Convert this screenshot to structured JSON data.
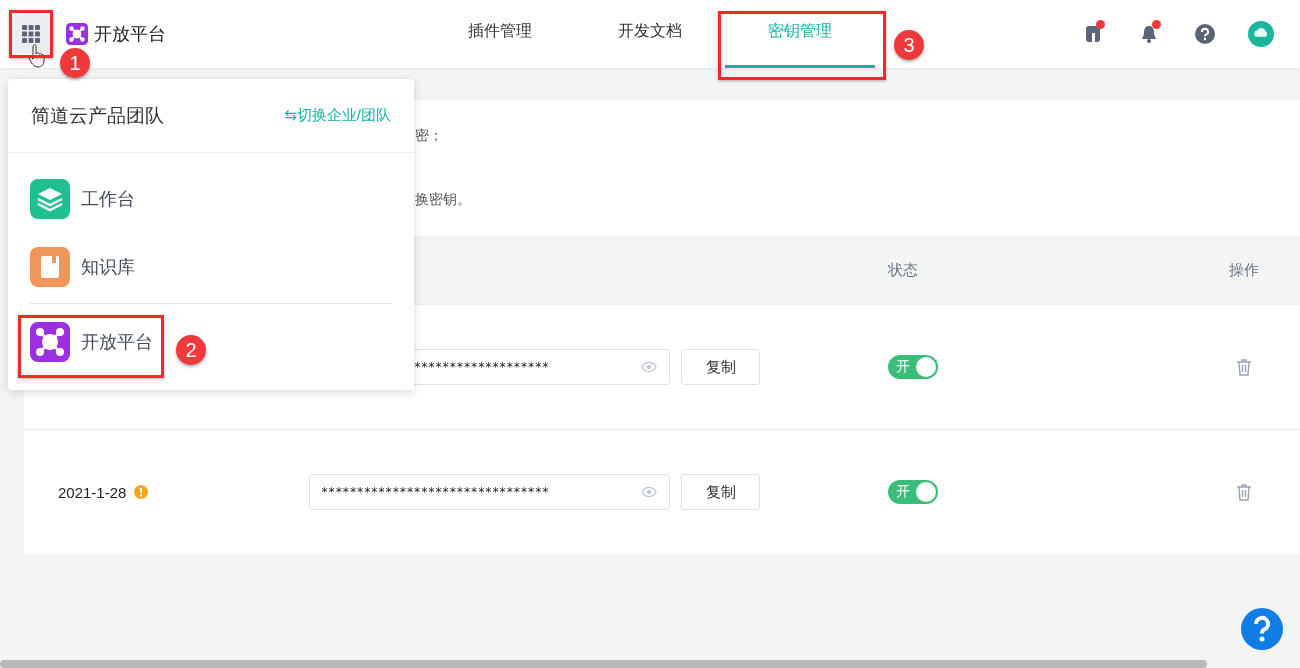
{
  "header": {
    "app_name": "开放平台",
    "tabs": [
      {
        "label": "插件管理",
        "selected": false
      },
      {
        "label": "开发文档",
        "selected": false
      },
      {
        "label": "密钥管理",
        "selected": true
      }
    ],
    "icons": [
      {
        "kind": "notebook",
        "unread": true
      },
      {
        "kind": "bell",
        "unread": true
      },
      {
        "kind": "help",
        "unread": false
      },
      {
        "kind": "avatar",
        "unread": false
      }
    ]
  },
  "notice": {
    "lines": [
      "密；",
      "换密钥。"
    ]
  },
  "table": {
    "columns": {
      "status": "状态",
      "actions": "操作"
    },
    "rows": [
      {
        "key": "*******************",
        "copy_label": "复制",
        "on": true,
        "toggle_label": "开"
      },
      {
        "date": "2021-1-28",
        "warning": true,
        "key": "********************************",
        "copy_label": "复制",
        "on": true,
        "toggle_label": "开"
      }
    ]
  },
  "app_menu": {
    "team_name": "简道云产品团队",
    "switch_link": "⇆切换企业/团队",
    "apps": [
      {
        "kind": "workbench",
        "label": "工作台"
      },
      {
        "kind": "knowledge",
        "label": "知识库"
      }
    ],
    "pinned_apps": [
      {
        "kind": "open_platform",
        "label": "开放平台"
      }
    ]
  },
  "annotations": [
    {
      "number": "1"
    },
    {
      "number": "2"
    },
    {
      "number": "3"
    }
  ]
}
